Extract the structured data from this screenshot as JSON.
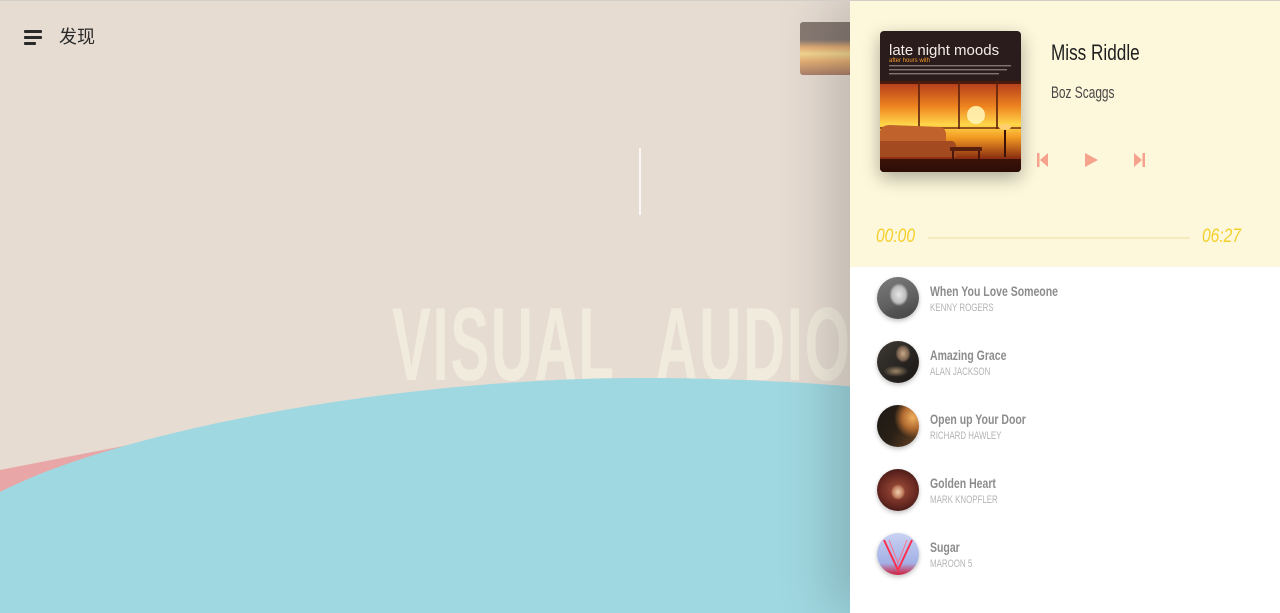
{
  "app": {
    "nav_label": "发现",
    "menu_icon": "menu-icon"
  },
  "hero": {
    "title": "VISUAL AUDIO"
  },
  "colors": {
    "bg": "#e6dcd2",
    "accent": "#f6a38d",
    "time": "#f3d02c",
    "header": "#fdf7db",
    "wave-blue": "#a0d8e1",
    "wave-pink": "#e8a6a6"
  },
  "now_playing": {
    "album_title": "late night moods",
    "album_tagline": "after hours with",
    "title": "Miss Riddle",
    "artist": "Boz Scaggs",
    "current_time": "00:00",
    "duration": "06:27",
    "progress": 0,
    "controls": {
      "previous": "skip-previous-icon",
      "play": "play-icon",
      "next": "skip-next-icon"
    }
  },
  "playlist": [
    {
      "title": "When You Love Someone",
      "artist": "KENNY ROGERS"
    },
    {
      "title": "Amazing Grace",
      "artist": "ALAN JACKSON"
    },
    {
      "title": "Open up Your Door",
      "artist": "RICHARD HAWLEY"
    },
    {
      "title": "Golden Heart",
      "artist": "MARK KNOPFLER"
    },
    {
      "title": "Sugar",
      "artist": "MAROON 5"
    }
  ]
}
